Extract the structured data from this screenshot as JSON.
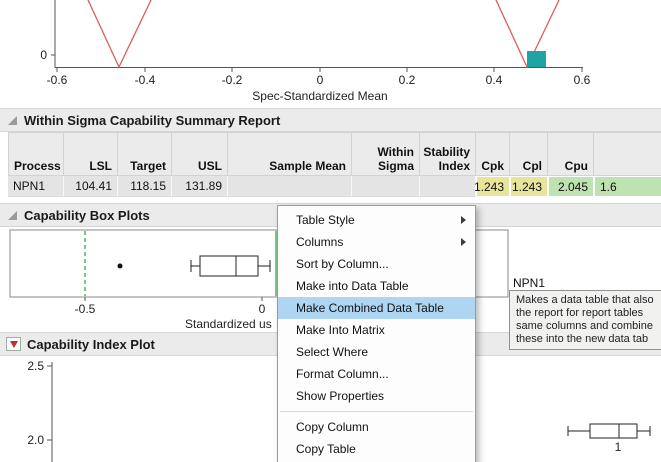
{
  "top_chart": {
    "y_ticks": [
      "0"
    ],
    "x_ticks": [
      "-0.6",
      "-0.4",
      "-0.2",
      "0",
      "0.2",
      "0.4",
      "0.6"
    ],
    "axis_label": "Spec-Standardized Mean",
    "colors": {
      "line": "#e05c5c",
      "marker": "#1fa4a4"
    }
  },
  "summary": {
    "title": "Within Sigma Capability Summary Report",
    "headers": [
      "Process",
      "LSL",
      "Target",
      "USL",
      "Sample Mean",
      "Within\nSigma",
      "Stability\nIndex",
      "Cpk",
      "Cpl",
      "Cpu"
    ],
    "row": {
      "process": "NPN1",
      "lsl": "104.41",
      "target": "118.15",
      "usl": "131.89",
      "sample_mean": "",
      "within_sigma": "",
      "stability_index": "",
      "cpk": "1.243",
      "cpl": "1.243",
      "cpu": "2.045",
      "last": "1.6"
    },
    "cell_colors": {
      "yellow": "#e7e49c",
      "green": "#bfe2b2"
    }
  },
  "box_plots": {
    "title": "Capability Box Plots",
    "x_ticks": [
      "-0.5",
      "0"
    ],
    "axis_label": "Standardized us",
    "process_label": "NPN1",
    "colors": {
      "spec_line": "#2f9e41"
    }
  },
  "index_plot": {
    "title": "Capability Index Plot",
    "y_ticks": [
      "2.5",
      "2.0"
    ],
    "x_ticks": [
      "1"
    ]
  },
  "menu": {
    "items": [
      {
        "label": "Table Style",
        "submenu": true
      },
      {
        "label": "Columns",
        "submenu": true
      },
      {
        "label": "Sort by Column...",
        "submenu": false
      },
      {
        "label": "Make into Data Table",
        "submenu": false
      },
      {
        "label": "Make Combined Data Table",
        "submenu": false,
        "highlighted": true
      },
      {
        "label": "Make Into Matrix",
        "submenu": false
      },
      {
        "label": "Select Where",
        "submenu": false
      },
      {
        "label": "Format Column...",
        "submenu": false
      },
      {
        "label": "Show Properties",
        "submenu": false
      },
      {
        "label": "Copy Column",
        "submenu": false
      },
      {
        "label": "Copy Table",
        "submenu": false
      }
    ]
  },
  "tooltip": {
    "lines": [
      "Makes a data table that also",
      "the report for report tables",
      "same columns and combine",
      "these into the new data tab"
    ]
  }
}
